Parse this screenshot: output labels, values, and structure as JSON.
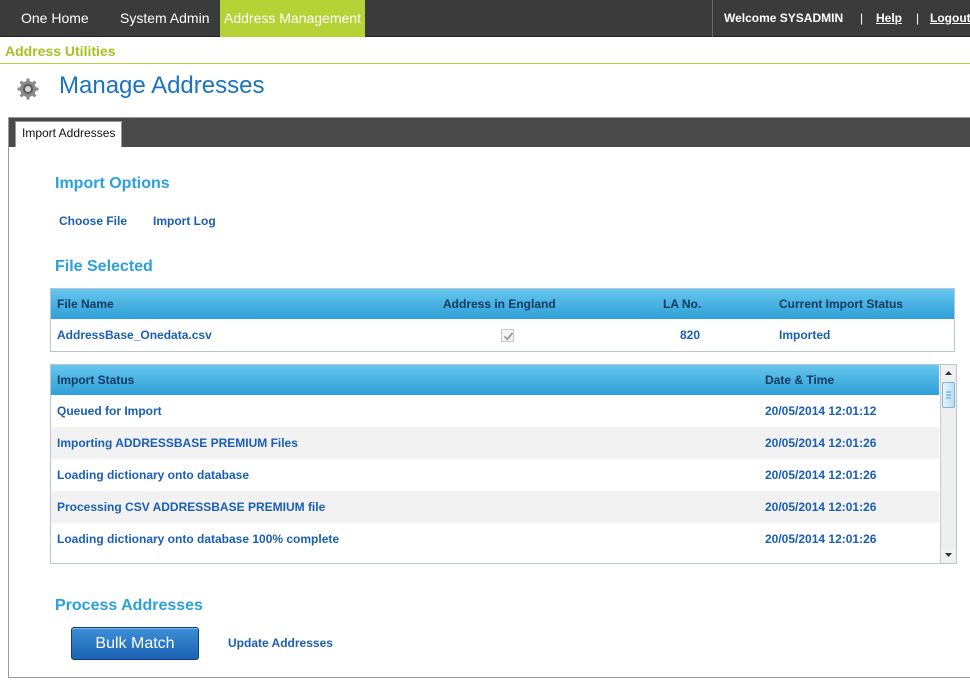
{
  "nav": {
    "items": [
      "One Home",
      "System Admin",
      "Address Management"
    ],
    "active_index": 2,
    "welcome": "Welcome SYSADMIN",
    "separator": "|",
    "help": "Help",
    "logout": "Logout"
  },
  "subheader": {
    "title": "Address Utilities"
  },
  "page": {
    "title": "Manage Addresses",
    "icon": "gear-icon"
  },
  "tabs": [
    {
      "label": "Import Addresses",
      "active": true
    }
  ],
  "import_options": {
    "title": "Import Options",
    "links": [
      "Choose File",
      "Import Log"
    ]
  },
  "file_selected": {
    "title": "File Selected",
    "columns": [
      "File Name",
      "Address in England",
      "LA No.",
      "Current Import Status"
    ],
    "rows": [
      {
        "file_name": "AddressBase_Onedata.csv",
        "in_england": true,
        "la_no": "820",
        "status": "Imported"
      }
    ]
  },
  "import_status": {
    "columns": [
      "Import Status",
      "Date & Time"
    ],
    "rows": [
      {
        "status": "Queued for Import",
        "datetime": "20/05/2014 12:01:12"
      },
      {
        "status": "Importing ADDRESSBASE PREMIUM Files",
        "datetime": "20/05/2014 12:01:26"
      },
      {
        "status": "Loading dictionary onto database",
        "datetime": "20/05/2014 12:01:26"
      },
      {
        "status": "Processing CSV ADDRESSBASE PREMIUM file",
        "datetime": "20/05/2014 12:01:26"
      },
      {
        "status": "Loading dictionary onto database 100% complete",
        "datetime": "20/05/2014 12:01:26"
      }
    ]
  },
  "process_addresses": {
    "title": "Process Addresses",
    "primary_button": "Bulk Match",
    "secondary_link": "Update Addresses"
  },
  "colors": {
    "accent_green": "#b5d334",
    "title_blue": "#1a74c1",
    "section_blue": "#2aa1d8",
    "link_blue": "#1a5fb4",
    "nav_dark": "#3b3b3b"
  }
}
